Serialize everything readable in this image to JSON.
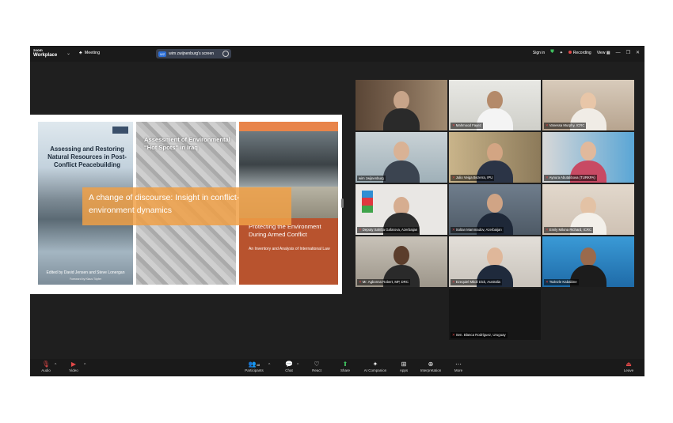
{
  "titlebar": {
    "brand_top": "zoom",
    "brand_bottom": "Workplace",
    "meeting_label": "Meeting",
    "screen_badge": "WZ",
    "screen_label": "wim zwijnenburg's screen",
    "sign_in": "Sign in",
    "recording": "Recording",
    "view": "View"
  },
  "share": {
    "book1_title": "Assessing and Restoring Natural Resources in Post-Conflict Peacebuilding",
    "book1_editors": "Edited by David Jensen and Steve Lonergan",
    "book1_foreword": "Foreword by Klaus Töpfer",
    "book2_title": "Assessment of Environmental \"Hot Spots\" in Iraq",
    "book3_title": "Protecting the Environment During Armed Conflict",
    "book3_subtitle": "An Inventory and Analysis of International Law",
    "banner": "A change of discourse: Insight in conflict-environment dynamics"
  },
  "participants": [
    {
      "name": ""
    },
    {
      "name": "Mahmood Fayez"
    },
    {
      "name": "Vanessa Murphy, ICRC"
    },
    {
      "name": "wim zwijnenburg"
    },
    {
      "name": "Julio Veiga Bezerra, IPU"
    },
    {
      "name": "Aynura Abutalibova (TURKPA)"
    },
    {
      "name": "Deputy Sahiba Gafarova, Azerbaijan"
    },
    {
      "name": "Soltan Mammadov, Azerbaijan"
    },
    {
      "name": "Emily Milona Richard, ICRC"
    },
    {
      "name": "Mr. Agbonna Robert, MP, DRC"
    },
    {
      "name": "Ezequiel Mitoli Dick, Australia"
    },
    {
      "name": "Tsolezle Kababine"
    },
    {
      "name": "Sen. Blanca Rodríguez, Uruguay"
    }
  ],
  "toolbar": {
    "audio": "Audio",
    "video": "Video",
    "participants": "Participants",
    "participants_count": "48",
    "chat": "Chat",
    "react": "React",
    "share": "Share",
    "ai": "AI Companion",
    "apps": "Apps",
    "interpretation": "Interpretation",
    "more": "More",
    "leave": "Leave"
  }
}
